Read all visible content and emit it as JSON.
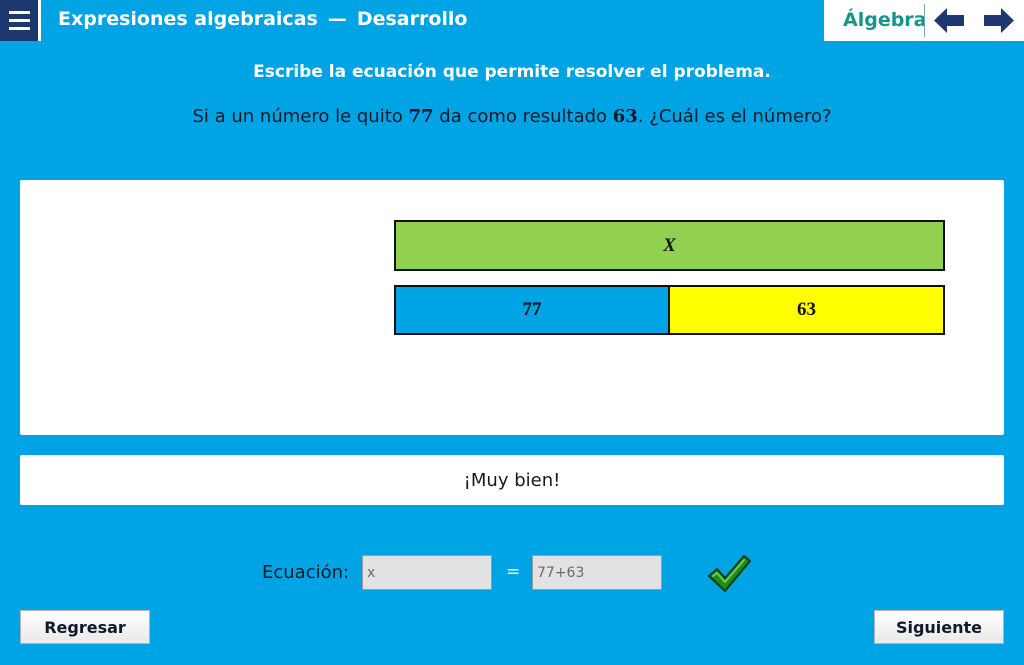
{
  "header": {
    "title": "Expresiones algebraicas",
    "separator": "—",
    "section": "Desarrollo",
    "subject": "Álgebra",
    "icons": {
      "menu": "hamburger-menu-icon",
      "prev": "arrow-left-icon",
      "next": "arrow-right-icon"
    }
  },
  "instruction": "Escribe la ecuación que permite resolver el problema.",
  "problem": {
    "part1": "Si a un número le quito ",
    "value1": "77",
    "part2": " da como resultado ",
    "value2": "63",
    "part3": ". ¿Cuál es el número?"
  },
  "diagram": {
    "total_label": "X",
    "part1_label": "77",
    "part2_label": "63",
    "part1_value": 77,
    "part2_value": 63,
    "colors": {
      "total": "#92d050",
      "part1": "#00a3e4",
      "part2": "#ffff00"
    }
  },
  "feedback": "¡Muy bien!",
  "equation": {
    "label": "Ecuación:",
    "left_value": "x",
    "sign": "=",
    "right_value": "77+63",
    "status_icon": "checkmark-icon"
  },
  "buttons": {
    "back": "Regresar",
    "next": "Siguiente"
  },
  "colors": {
    "background": "#00a3e4",
    "header_dark": "#1d3870",
    "accent": "#15958c"
  }
}
